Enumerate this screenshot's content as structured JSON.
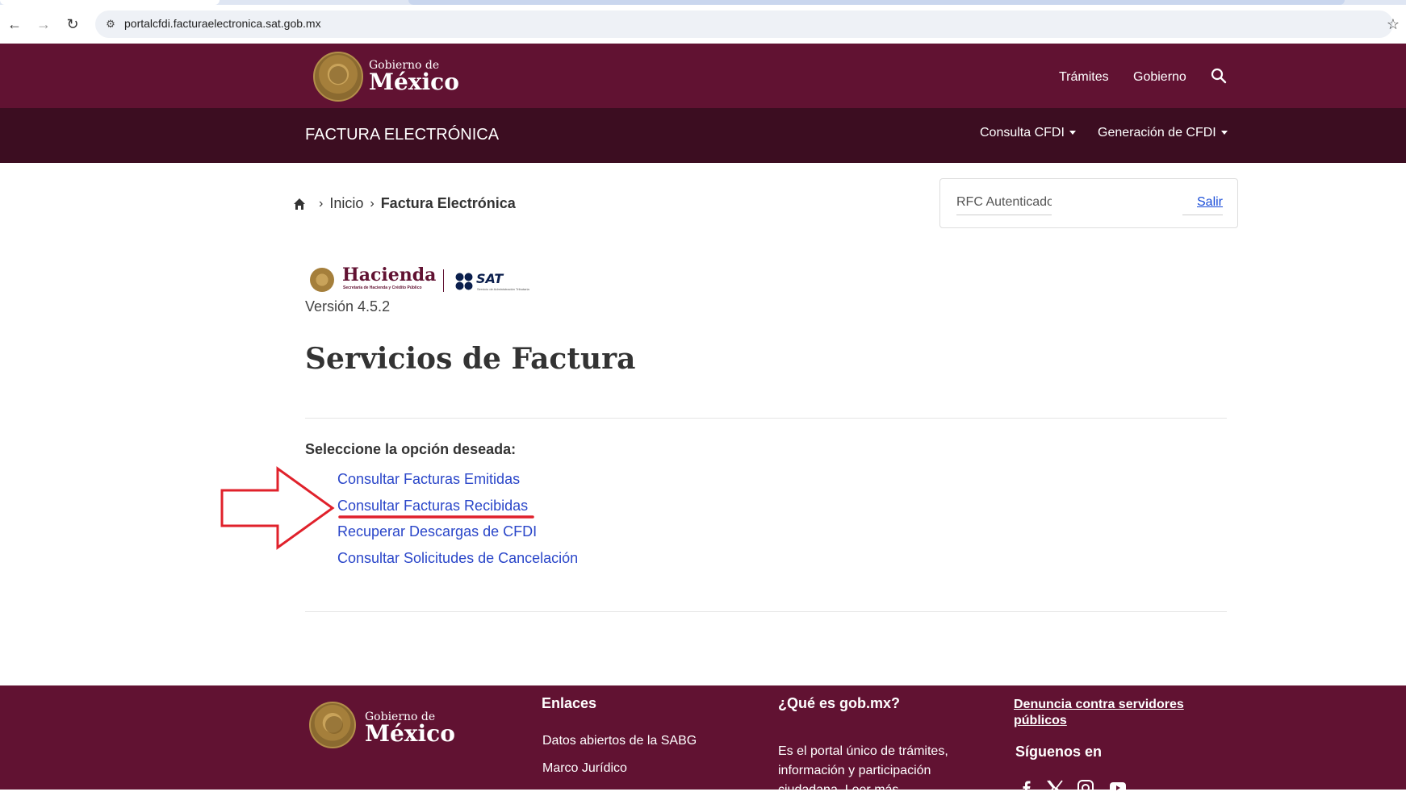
{
  "browser": {
    "url": "portalcfdi.facturaelectronica.sat.gob.mx",
    "back_icon": "arrow-left-icon",
    "forward_icon": "arrow-right-icon",
    "reload_icon": "reload-icon",
    "bookmark_icon": "star-icon"
  },
  "gob_header": {
    "logo_small": "Gobierno de",
    "logo_big": "México",
    "nav": [
      "Trámites",
      "Gobierno"
    ],
    "search_icon": "search-icon"
  },
  "sub_header": {
    "title": "FACTURA ELECTRÓNICA",
    "menus": [
      "Consulta CFDI",
      "Generación de CFDI"
    ]
  },
  "breadcrumb": {
    "home_icon": "home-icon",
    "items": [
      "Inicio",
      "Factura Electrónica"
    ]
  },
  "auth": {
    "rfc_label": "RFC Autenticado",
    "logout": "Salir"
  },
  "logos": {
    "hacienda": "Hacienda",
    "hacienda_sub": "Secretaría de Hacienda y Crédito Público",
    "sat": "SAT",
    "sat_sub": "Servicio de Administración Tributaria"
  },
  "main": {
    "version": "Versión 4.5.2",
    "title": "Servicios de Factura",
    "prompt": "Seleccione la opción deseada:",
    "options": [
      "Consultar Facturas Emitidas",
      "Consultar Facturas Recibidas",
      "Recuperar Descargas de CFDI",
      "Consultar Solicitudes de Cancelación"
    ]
  },
  "annotation": {
    "arrow_color": "#e0212b",
    "highlighted_option": "Consultar Facturas Recibidas"
  },
  "footer": {
    "logo_small": "Gobierno de",
    "logo_big": "México",
    "enlaces_title": "Enlaces",
    "enlaces": [
      "Datos abiertos de la SABG",
      "Marco Jurídico"
    ],
    "que_es_title": "¿Qué es gob.mx?",
    "que_es_text": "Es el portal único de trámites, información y participación ciudadana. Leer más",
    "denuncia": "Denuncia contra servidores públicos",
    "siguenos": "Síguenos en",
    "social_icons": [
      "facebook-icon",
      "x-icon",
      "instagram-icon",
      "youtube-icon"
    ]
  },
  "colors": {
    "gob_primary": "#611232",
    "gob_dark": "#3c0d21",
    "link": "#2a46c9"
  }
}
